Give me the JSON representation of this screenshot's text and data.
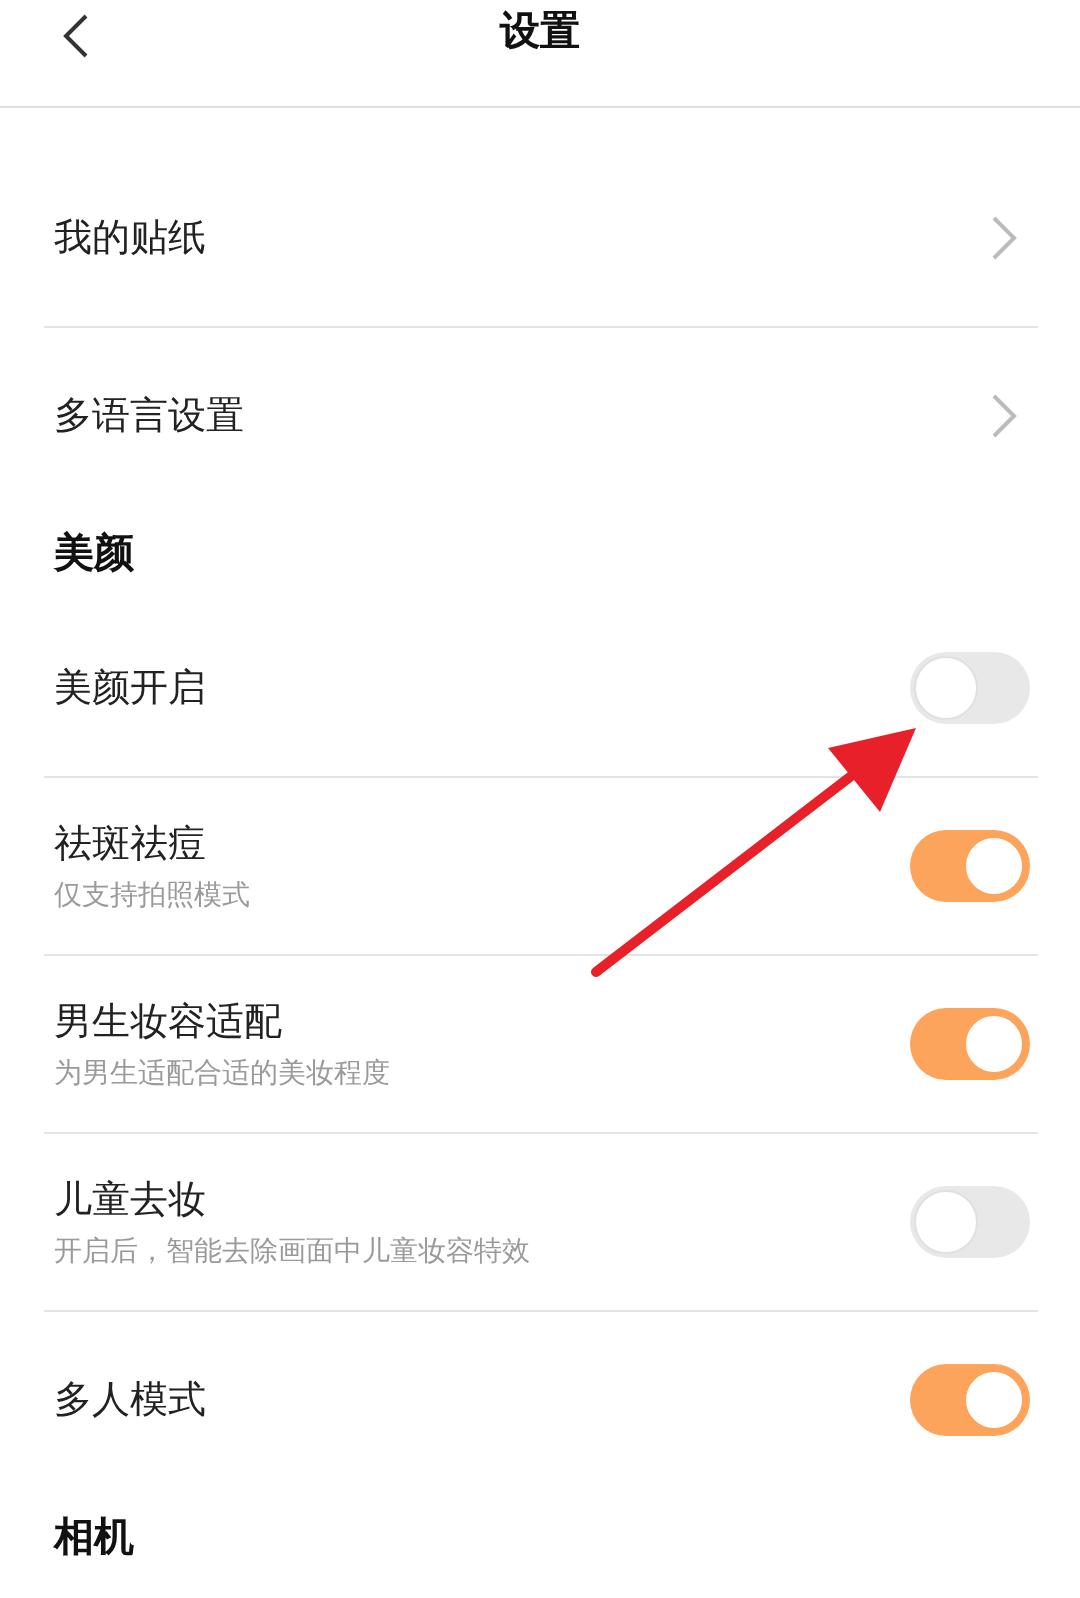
{
  "header": {
    "title": "设置"
  },
  "sections": [
    {
      "items": [
        {
          "kind": "link",
          "label": "我的贴纸"
        },
        {
          "kind": "link",
          "label": "多语言设置"
        }
      ]
    },
    {
      "title": "美颜",
      "items": [
        {
          "kind": "toggle",
          "label": "美颜开启",
          "on": false
        },
        {
          "kind": "toggle",
          "label": "祛斑祛痘",
          "subtitle": "仅支持拍照模式",
          "on": true
        },
        {
          "kind": "toggle",
          "label": "男生妆容适配",
          "subtitle": "为男生适配合适的美妆程度",
          "on": true
        },
        {
          "kind": "toggle",
          "label": "儿童去妆",
          "subtitle": "开启后，智能去除画面中儿童妆容特效",
          "on": false
        },
        {
          "kind": "toggle",
          "label": "多人模式",
          "on": true
        }
      ]
    },
    {
      "title": "相机"
    }
  ]
}
